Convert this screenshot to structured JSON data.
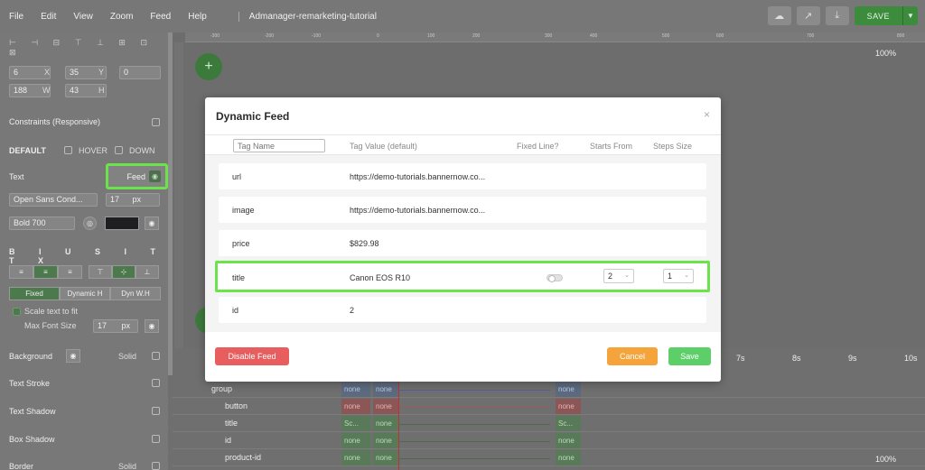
{
  "menu": [
    "File",
    "Edit",
    "View",
    "Zoom",
    "Feed",
    "Help"
  ],
  "doc_title": "Admanager-remarketing-tutorial",
  "toolbar": {
    "save_label": "SAVE"
  },
  "left_panel": {
    "pos": {
      "x": "6",
      "x_label": "X",
      "y": "35",
      "y_label": "Y",
      "rot": "0",
      "w": "188",
      "w_label": "W",
      "h": "43",
      "h_label": "H"
    },
    "constraints_label": "Constraints (Responsive)",
    "states": {
      "default": "DEFAULT",
      "hover": "HOVER",
      "down": "DOWN"
    },
    "text_label": "Text",
    "feed_label": "Feed",
    "font_family": "Open Sans Cond...",
    "font_size": "17",
    "font_unit": "px",
    "font_weight": "Bold 700",
    "modes": [
      "Fixed",
      "Dynamic H",
      "Dyn W.H"
    ],
    "scale_text": "Scale text to fit",
    "max_font_label": "Max Font Size",
    "max_font_value": "17",
    "max_font_unit": "px",
    "sections": {
      "background": "Background",
      "background_value": "Solid",
      "text_stroke": "Text Stroke",
      "text_shadow": "Text Shadow",
      "box_shadow": "Box Shadow",
      "border": "Border",
      "border_value": "Solid"
    }
  },
  "canvas": {
    "zoom_top": "100%",
    "zoom_bottom": "100%",
    "ruler": [
      "-300",
      "-200",
      "-100",
      "0",
      "100",
      "200",
      "300",
      "400",
      "500",
      "600",
      "700",
      "800"
    ]
  },
  "timeline": {
    "rows": [
      {
        "name": "group",
        "c1": "none",
        "c2": "none",
        "c3": "none",
        "color": "blue"
      },
      {
        "name": "button",
        "c1": "none",
        "c2": "none",
        "c3": "none",
        "color": "red"
      },
      {
        "name": "title",
        "c1": "Sc...",
        "c2": "none",
        "c3": "Sc...",
        "color": "green"
      },
      {
        "name": "id",
        "c1": "none",
        "c2": "none",
        "c3": "none",
        "color": "green"
      },
      {
        "name": "product-id",
        "c1": "none",
        "c2": "none",
        "c3": "none",
        "color": "green"
      }
    ],
    "time_marks": [
      "7s",
      "8s",
      "9s",
      "10s"
    ]
  },
  "modal": {
    "title": "Dynamic Feed",
    "close": "×",
    "headers": {
      "tag_name_placeholder": "Tag Name",
      "tag_value": "Tag Value (default)",
      "fixed_line": "Fixed Line?",
      "starts_from": "Starts From",
      "steps_size": "Steps Size"
    },
    "rows": [
      {
        "name": "url",
        "value": "https://demo-tutorials.bannernow.co..."
      },
      {
        "name": "image",
        "value": "https://demo-tutorials.bannernow.co..."
      },
      {
        "name": "price",
        "value": "$829.98"
      },
      {
        "name": "title",
        "value": "Canon EOS R10",
        "starts_from": "2",
        "steps_size": "1",
        "fixed_line": false
      },
      {
        "name": "id",
        "value": "2"
      }
    ],
    "buttons": {
      "disable": "Disable Feed",
      "cancel": "Cancel",
      "save": "Save"
    }
  },
  "colors": {
    "highlight": "#6be34a",
    "danger": "#e85e5e",
    "warning": "#f4a43a",
    "success": "#5ccf68"
  }
}
